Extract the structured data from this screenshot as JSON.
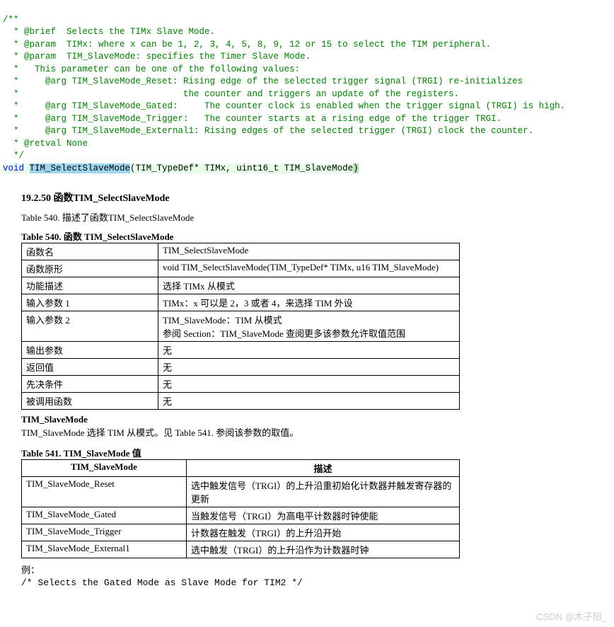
{
  "code": {
    "lines": [
      "/**",
      "  * @brief  Selects the TIMx Slave Mode.",
      "  * @param  TIMx: where x can be 1, 2, 3, 4, 5, 8, 9, 12 or 15 to select the TIM peripheral.",
      "  * @param  TIM_SlaveMode: specifies the Timer Slave Mode.",
      "  *   This parameter can be one of the following values:",
      "  *     @arg TIM_SlaveMode_Reset: Rising edge of the selected trigger signal (TRGI) re-initializes",
      "  *                               the counter and triggers an update of the registers.",
      "  *     @arg TIM_SlaveMode_Gated:     The counter clock is enabled when the trigger signal (TRGI) is high.",
      "  *     @arg TIM_SlaveMode_Trigger:   The counter starts at a rising edge of the trigger TRGI.",
      "  *     @arg TIM_SlaveMode_External1: Rising edges of the selected trigger (TRGI) clock the counter.",
      "  * @retval None",
      "  */"
    ],
    "sig_kw": "void ",
    "sig_name": "TIM_SelectSlaveMode",
    "sig_open": "(",
    "sig_args": "TIM_TypeDef* TIMx, uint16_t TIM_SlaveMode",
    "sig_close": ")"
  },
  "section": {
    "title": "19.2.50 函数TIM_SelectSlaveMode",
    "intro": "Table 540.  描述了函数TIM_SelectSlaveMode"
  },
  "table540": {
    "caption": "Table 540.  函数 TIM_SelectSlaveMode",
    "rows": [
      [
        "函数名",
        "TIM_SelectSlaveMode"
      ],
      [
        "函数原形",
        "void TIM_SelectSlaveMode(TIM_TypeDef* TIMx, u16 TIM_SlaveMode)"
      ],
      [
        "功能描述",
        "选择 TIMx 从模式"
      ],
      [
        "输入参数 1",
        "TIMx：x 可以是 2，3 或者 4，来选择 TIM 外设"
      ],
      [
        "输入参数 2",
        "TIM_SlaveMode：TIM 从模式\n参阅 Section：TIM_SlaveMode 查阅更多该参数允许取值范围"
      ],
      [
        "输出参数",
        "无"
      ],
      [
        "返回值",
        "无"
      ],
      [
        "先决条件",
        "无"
      ],
      [
        "被调用函数",
        "无"
      ]
    ]
  },
  "slave_mode": {
    "head": "TIM_SlaveMode",
    "desc": "TIM_SlaveMode 选择 TIM 从模式。见 Table 541.  参阅该参数的取值。"
  },
  "table541": {
    "caption": "Table 541. TIM_SlaveMode 值",
    "header": [
      "TIM_SlaveMode",
      "描述"
    ],
    "rows": [
      [
        "TIM_SlaveMode_Reset",
        "选中触发信号（TRGI）的上升沿重初始化计数器并触发寄存器的更新"
      ],
      [
        "TIM_SlaveMode_Gated",
        "当触发信号（TRGI）为高电平计数器时钟使能"
      ],
      [
        "TIM_SlaveMode_Trigger",
        "计数器在触发（TRGI）的上升沿开始"
      ],
      [
        "TIM_SlaveMode_External1",
        "选中触发（TRGI）的上升沿作为计数器时钟"
      ]
    ]
  },
  "example": {
    "label": "例：",
    "code": "/* Selects the Gated Mode as Slave Mode for TIM2 */"
  },
  "watermark": "CSDN @木子阳_"
}
